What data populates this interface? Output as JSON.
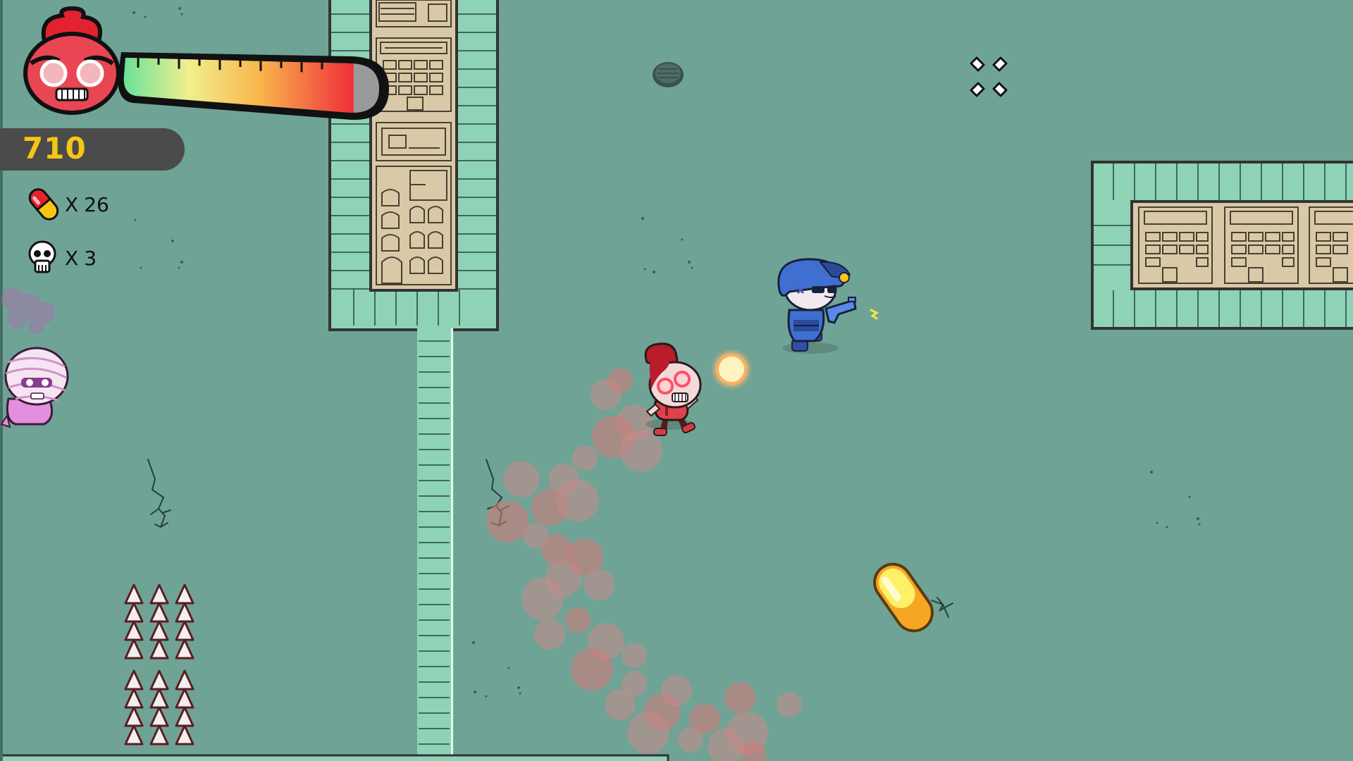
{
  "hud": {
    "rage_level": 0.9,
    "score": "710",
    "pills": {
      "prefix": "X",
      "count": "26"
    },
    "kills": {
      "prefix": "X",
      "count": "3"
    }
  },
  "colors": {
    "ground": "#6fa396",
    "wall": "#8fd3b7",
    "building": "#d9c9a6",
    "rage_red": "#ea3b3f",
    "score_yellow": "#f5c518",
    "police_blue": "#3f6fd0",
    "pill_yellow": "#f7d23a"
  },
  "icons": {
    "rage": "zombie-rage-face-icon",
    "pill": "pill-capsule-icon",
    "kills": "skull-icon",
    "fullscreen": "fullscreen-toggle-icon"
  },
  "entities": {
    "player": "zombie-player",
    "enemy": "police-officer",
    "mummy": "mummy-zombie",
    "pickup": "yellow-pill-pickup"
  }
}
